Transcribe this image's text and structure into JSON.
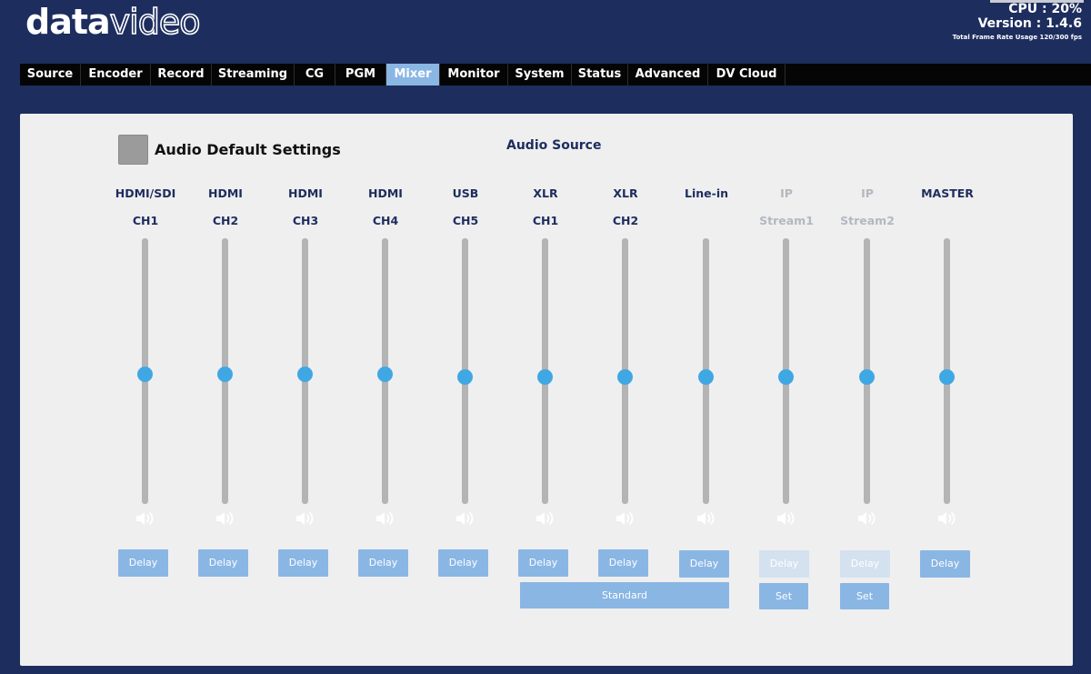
{
  "brand": {
    "logo_bold": "data",
    "logo_thin": "video"
  },
  "status": {
    "cpu": "CPU : 20%",
    "version": "Version : 1.4.6",
    "frame_rate": "Total Frame Rate Usage 120/300 fps"
  },
  "nav": {
    "tabs": [
      {
        "label": "Source"
      },
      {
        "label": "Encoder"
      },
      {
        "label": "Record"
      },
      {
        "label": "Streaming"
      },
      {
        "label": "CG"
      },
      {
        "label": "PGM"
      },
      {
        "label": "Mixer"
      },
      {
        "label": "Monitor"
      },
      {
        "label": "System"
      },
      {
        "label": "Status"
      },
      {
        "label": "Advanced"
      },
      {
        "label": "DV Cloud"
      }
    ],
    "active": "Mixer"
  },
  "mixer": {
    "default_settings_label": "Audio Default Settings",
    "audio_source_title": "Audio Source",
    "channels": [
      {
        "l1": "HDMI/SDI",
        "l2": "CH1",
        "level": 0.49,
        "delay": "Delay",
        "enabled": true
      },
      {
        "l1": "HDMI",
        "l2": "CH2",
        "level": 0.49,
        "delay": "Delay",
        "enabled": true
      },
      {
        "l1": "HDMI",
        "l2": "CH3",
        "level": 0.49,
        "delay": "Delay",
        "enabled": true
      },
      {
        "l1": "HDMI",
        "l2": "CH4",
        "level": 0.49,
        "delay": "Delay",
        "enabled": true
      },
      {
        "l1": "USB",
        "l2": "CH5",
        "level": 0.48,
        "delay": "Delay",
        "enabled": true
      },
      {
        "l1": "XLR",
        "l2": "CH1",
        "level": 0.48,
        "delay": "Delay",
        "enabled": true
      },
      {
        "l1": "XLR",
        "l2": "CH2",
        "level": 0.48,
        "delay": "Delay",
        "enabled": true
      },
      {
        "l1": "Line-in",
        "l2": "",
        "level": 0.48,
        "delay": "Delay",
        "enabled": true
      },
      {
        "l1": "IP",
        "l2": "Stream1",
        "level": 0.48,
        "delay": "Delay",
        "enabled": false,
        "set": "Set"
      },
      {
        "l1": "IP",
        "l2": "Stream2",
        "level": 0.48,
        "delay": "Delay",
        "enabled": false,
        "set": "Set"
      },
      {
        "l1": "MASTER",
        "l2": "",
        "level": 0.48,
        "delay": "Delay",
        "enabled": true
      }
    ],
    "xlr_mode_button": "Standard"
  },
  "colors": {
    "accent": "#8ab6e4",
    "knob": "#3fa8e4",
    "navy": "#1d2d5e"
  },
  "icons": {
    "channel_icon": "speaker-icon",
    "default_checkbox": "checkbox"
  }
}
